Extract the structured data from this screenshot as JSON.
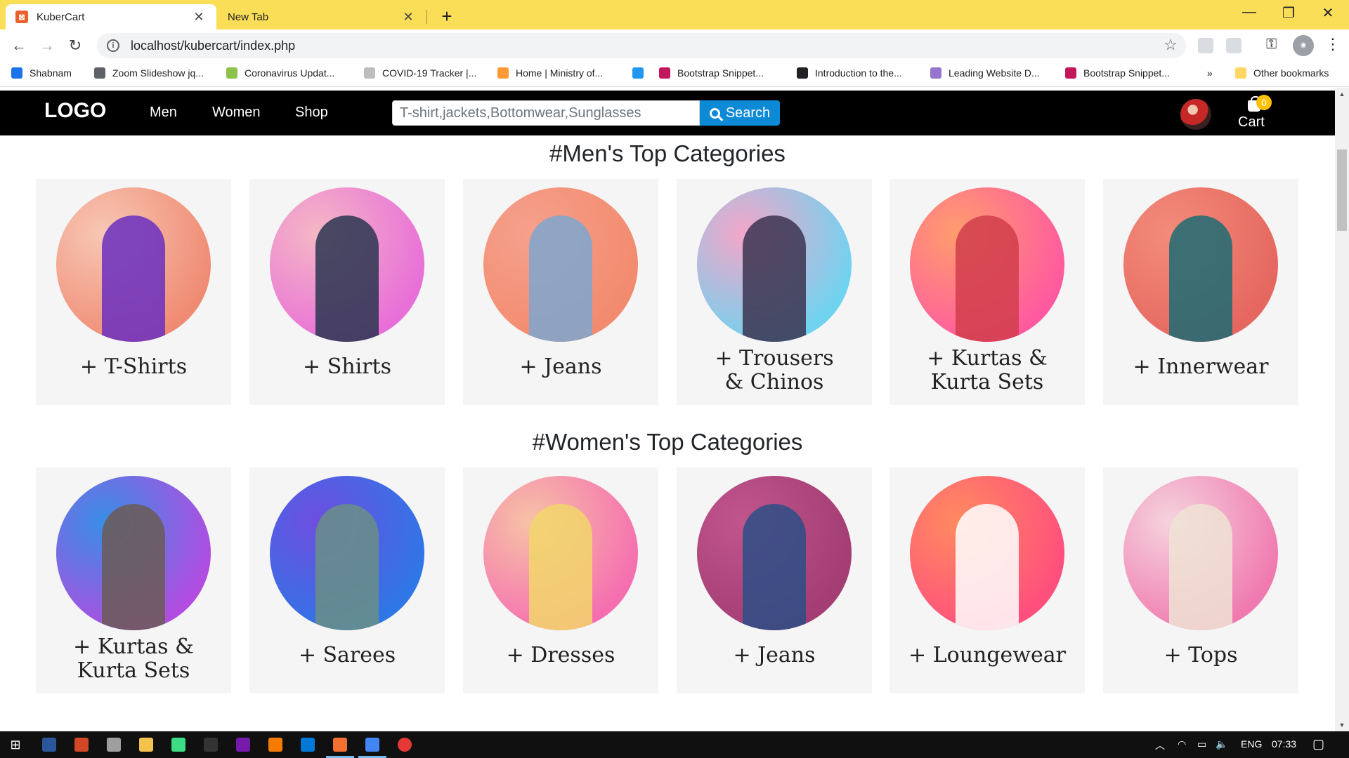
{
  "browser": {
    "tabs": [
      {
        "title": "KuberCart",
        "active": true
      },
      {
        "title": "New Tab",
        "active": false
      }
    ],
    "url": "localhost/kubercart/index.php",
    "bookmarks": [
      {
        "label": "Shabnam",
        "icon": "infinity-icon",
        "color": "#1a73e8"
      },
      {
        "label": "Zoom Slideshow jq...",
        "icon": "doc-icon",
        "color": "#5f6368"
      },
      {
        "label": "Coronavirus Updat...",
        "icon": "w-icon",
        "color": "#8bc34a"
      },
      {
        "label": "COVID-19 Tracker |...",
        "icon": "tracker-icon",
        "color": "#bdbdbd"
      },
      {
        "label": "Home | Ministry of...",
        "icon": "flag-icon",
        "color": "#ff9933"
      },
      {
        "label": "",
        "icon": "g-icon",
        "color": "#2196f3"
      },
      {
        "label": "Bootstrap Snippet...",
        "icon": "m-icon",
        "color": "#c2185b"
      },
      {
        "label": "Introduction to the...",
        "icon": "globe-icon",
        "color": "#202124"
      },
      {
        "label": "Leading Website D...",
        "icon": "site-icon",
        "color": "#9575cd"
      },
      {
        "label": "Bootstrap Snippet...",
        "icon": "m-icon",
        "color": "#c2185b"
      }
    ],
    "bookmarks_overflow": "»",
    "other_bookmarks": "Other bookmarks"
  },
  "site": {
    "logo": "LOGO",
    "nav": [
      "Men",
      "Women",
      "Shop"
    ],
    "search_placeholder": "T-shirt,jackets,Bottomwear,Sunglasses",
    "search_button": "Search",
    "cart_label": "Cart",
    "cart_count": "0"
  },
  "sections": [
    {
      "title": "#Men's Top Categories",
      "items": [
        {
          "line1": "+ T-Shirts",
          "line2": "",
          "colors": [
            "#f7c7b4",
            "#f08b73",
            "#6a2fc0"
          ]
        },
        {
          "line1": "+ Shirts",
          "line2": "",
          "colors": [
            "#f5b7c5",
            "#e86fd8",
            "#2a3550"
          ]
        },
        {
          "line1": "+ Jeans",
          "line2": "",
          "colors": [
            "#f6a08c",
            "#f28b6e",
            "#7ea6cf"
          ]
        },
        {
          "line1": "+ Trousers",
          "line2": "& Chinos",
          "colors": [
            "#f3a6c9",
            "#6fd3f0",
            "#3b3450"
          ]
        },
        {
          "line1": "+ Kurtas &",
          "line2": "Kurta Sets",
          "colors": [
            "#ff9d6e",
            "#ff5aa0",
            "#d13d4b"
          ]
        },
        {
          "line1": "+ Innerwear",
          "line2": "",
          "colors": [
            "#f38c7a",
            "#e5675f",
            "#1c6b73"
          ]
        }
      ]
    },
    {
      "title": "#Women's Top Categories",
      "items": [
        {
          "line1": "+ Kurtas &",
          "line2": "Kurta Sets",
          "colors": [
            "#3a8de6",
            "#b14de0",
            "#6b5a56"
          ]
        },
        {
          "line1": "+ Sarees",
          "line2": "",
          "colors": [
            "#6d4fe0",
            "#2f76e6",
            "#6a8f86"
          ]
        },
        {
          "line1": "+ Dresses",
          "line2": "",
          "colors": [
            "#f7c2a6",
            "#f56fb0",
            "#f2d66b"
          ]
        },
        {
          "line1": "+ Jeans",
          "line2": "",
          "colors": [
            "#c0558c",
            "#a33d73",
            "#2d4e86"
          ]
        },
        {
          "line1": "+ Loungewear",
          "line2": "",
          "colors": [
            "#ff8a60",
            "#ff4f7d",
            "#ffffff"
          ]
        },
        {
          "line1": "+ Tops",
          "line2": "",
          "colors": [
            "#f5d3dd",
            "#f07ab0",
            "#efe3d4"
          ]
        }
      ]
    }
  ],
  "taskbar": {
    "apps": [
      {
        "name": "word-icon",
        "color": "#2b579a"
      },
      {
        "name": "powerpoint-icon",
        "color": "#d24726"
      },
      {
        "name": "tools-icon",
        "color": "#9e9e9e"
      },
      {
        "name": "file-explorer-icon",
        "color": "#f4c34e"
      },
      {
        "name": "android-studio-icon",
        "color": "#3ddc84"
      },
      {
        "name": "terminal-icon",
        "color": "#333333"
      },
      {
        "name": "onenote-icon",
        "color": "#7719aa"
      },
      {
        "name": "sublime-icon",
        "color": "#f57c00"
      },
      {
        "name": "vscode-icon",
        "color": "#0078d7"
      },
      {
        "name": "xampp-icon",
        "color": "#f36f32"
      },
      {
        "name": "chrome-icon",
        "color": "#4285f4"
      },
      {
        "name": "recorder-icon",
        "color": "#e53935"
      }
    ],
    "language": "ENG",
    "time": "07:33"
  }
}
